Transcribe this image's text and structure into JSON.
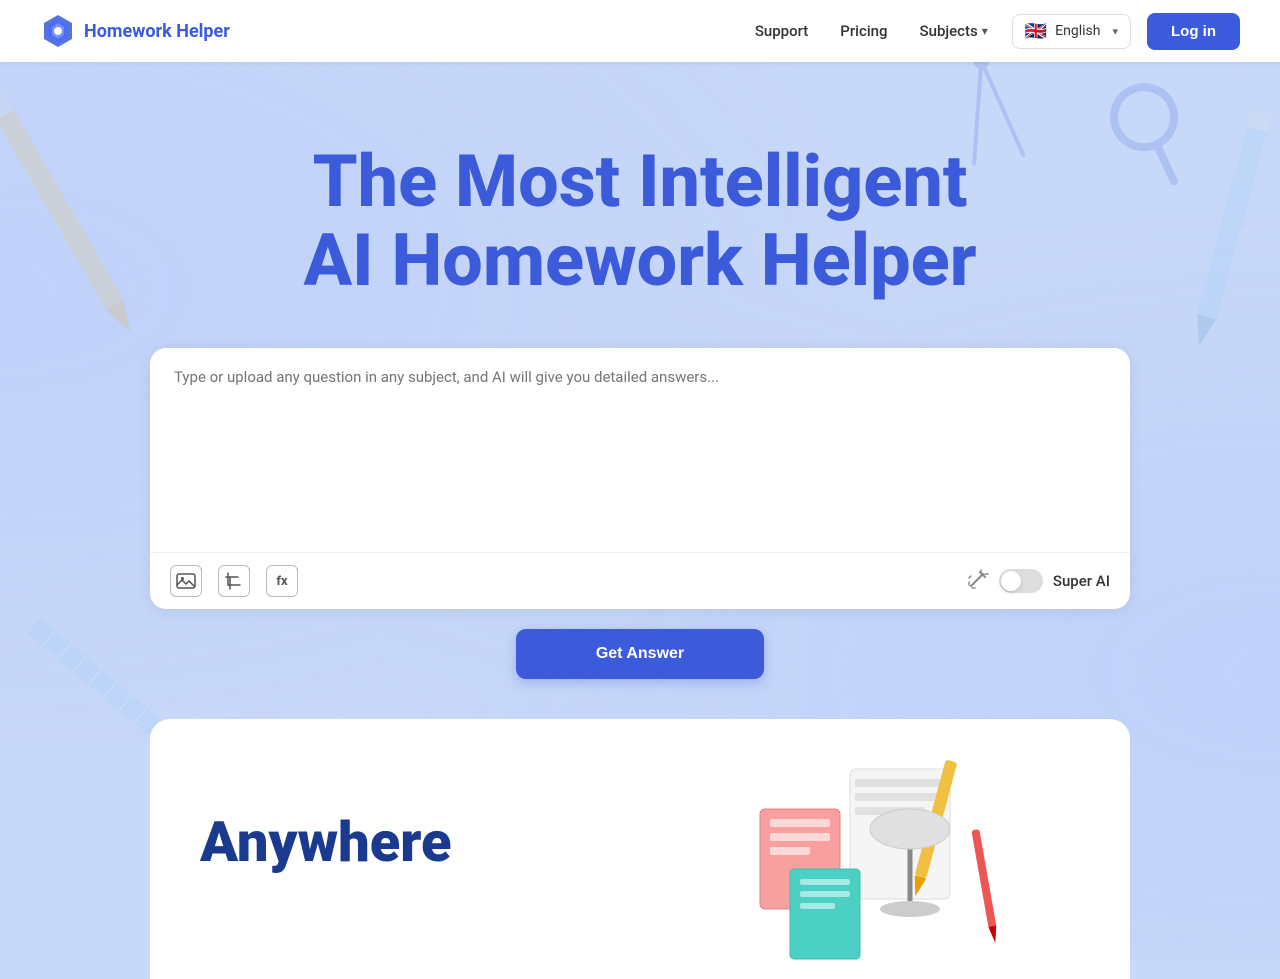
{
  "nav": {
    "logo_text": "Homework Helper",
    "links": {
      "support": "Support",
      "pricing": "Pricing",
      "subjects": "Subjects"
    },
    "language": {
      "label": "English",
      "flag": "🇬🇧"
    },
    "login": "Log in"
  },
  "hero": {
    "title_line1": "The Most Intelligent",
    "title_line2": "AI Homework Helper"
  },
  "question_box": {
    "placeholder": "Type or upload any question in any subject, and AI will give you detailed answers...",
    "super_ai_label": "Super AI"
  },
  "cta": {
    "get_answer": "Get Answer"
  },
  "bottom": {
    "anywhere_text": "Anywhere"
  },
  "toolbar": {
    "image_icon": "🖼",
    "crop_icon": "⌗",
    "formula_icon": "fx"
  }
}
